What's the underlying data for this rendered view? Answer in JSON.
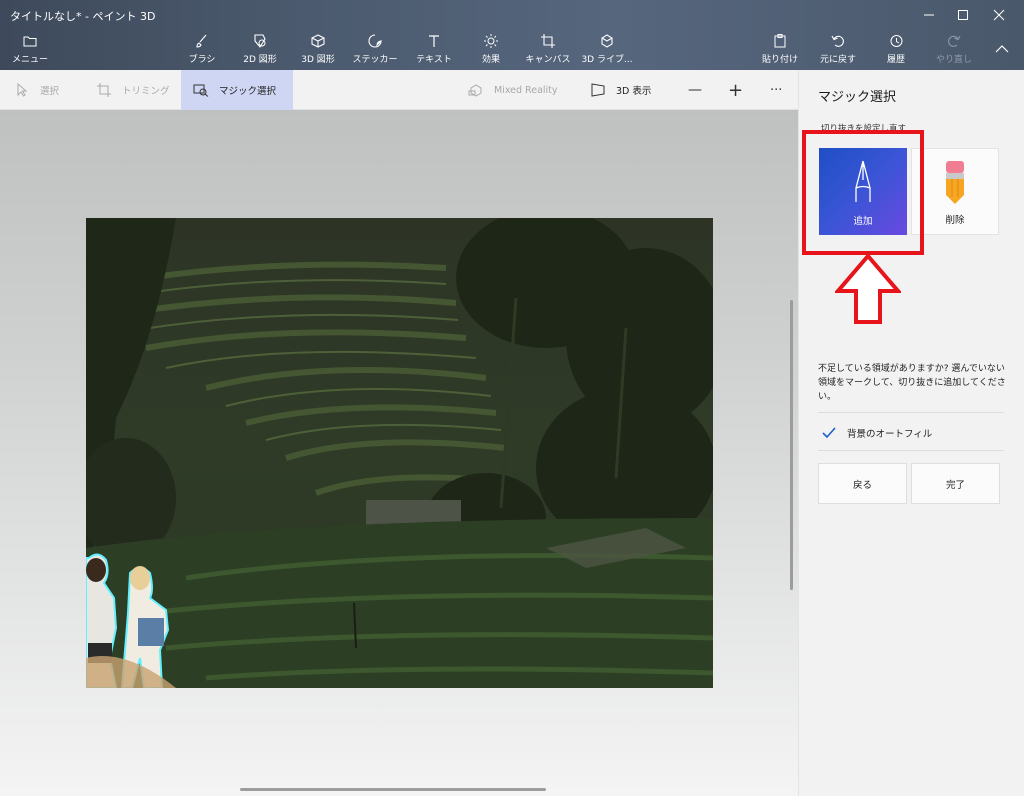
{
  "window": {
    "title": "タイトルなし* - ペイント 3D"
  },
  "ribbon": {
    "menu": "メニュー",
    "tools": [
      {
        "label": "ブラシ",
        "icon": "brush-icon"
      },
      {
        "label": "2D 図形",
        "icon": "shapes-2d-icon"
      },
      {
        "label": "3D 図形",
        "icon": "shapes-3d-icon"
      },
      {
        "label": "ステッカー",
        "icon": "sticker-icon"
      },
      {
        "label": "テキスト",
        "icon": "text-icon"
      },
      {
        "label": "効果",
        "icon": "effects-icon"
      },
      {
        "label": "キャンバス",
        "icon": "canvas-icon"
      },
      {
        "label": "3D ライブ...",
        "icon": "3d-library-icon"
      }
    ],
    "paste": "貼り付け",
    "undo": "元に戻す",
    "history": "履歴",
    "redo": "やり直し"
  },
  "toolbar": {
    "select": "選択",
    "crop": "トリミング",
    "magic_select": "マジック選択",
    "mixed_reality": "Mixed Reality",
    "view_3d": "3D 表示",
    "zoom_out": "—",
    "zoom_in": "+",
    "more": "···"
  },
  "panel": {
    "title": "マジック選択",
    "subtitle": "切り抜きを設定し直す",
    "add_label": "追加",
    "remove_label": "削除",
    "hint": "不足している領域がありますか? 選んでいない領域をマークして、切り抜きに追加してください。",
    "autofill_label": "背景のオートフィル",
    "autofill_checked": true,
    "back_label": "戻る",
    "done_label": "完了"
  },
  "colors": {
    "accent_start": "#1e4fc4",
    "accent_end": "#6a49e0",
    "highlight": "#e8141b",
    "active_tool_bg": "#cfd6f3"
  }
}
